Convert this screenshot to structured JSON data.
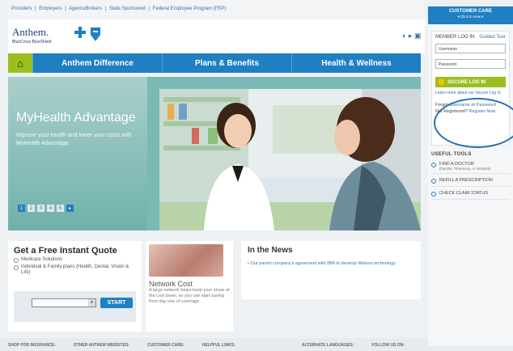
{
  "top_links": {
    "providers": "Providers",
    "employers": "Employers",
    "agents": "Agents/Brokers",
    "state": "State Sponsored",
    "federal": "Federal Employee Program (FEP)",
    "sep": "|"
  },
  "header": {
    "brand": "Anthem.",
    "tagline": "BlueCross BlueShield",
    "icons": "◐ ▸ ▣"
  },
  "nav": {
    "home_icon": "⌂",
    "items": [
      "Anthem Difference",
      "Plans & Benefits",
      "Health & Wellness"
    ]
  },
  "hero": {
    "title": "MyHealth Advantage",
    "subtitle": "Improve your health and lower your costs with MyHealth Advantage.",
    "pager": [
      "1",
      "2",
      "3",
      "4",
      "5",
      "▸"
    ]
  },
  "quote": {
    "title": "Get a Free Instant Quote",
    "options": [
      "Medicare Solutions",
      "Individual & Family plans (Health, Dental, Vision & Life)"
    ],
    "select_arrow": "▾",
    "button": "START"
  },
  "network": {
    "title": "Network Cost",
    "text": "A large network helps keep your share of the cost lower, so you can start saving from day one of coverage"
  },
  "news": {
    "title": "In the News",
    "item": "• Our parent company's agreement with IBM to develop Watson technology"
  },
  "customer_care": {
    "title": "CUSTOMER CARE",
    "sub": "▾ Click to view ▾"
  },
  "login": {
    "title": "MEMBER LOG IN",
    "tour": "Guided Tour",
    "username_placeholder": "Username",
    "password_placeholder": "Password",
    "button": "SECURE LOG IN",
    "learn": "Learn more about our Secure Log In",
    "forgot_prefix": "Forgot",
    "forgot_username": "Username",
    "or": "or",
    "forgot_password": "Password",
    "not_registered": "Not Registered?",
    "register": "Register Now"
  },
  "tools": {
    "title": "USEFUL TOOLS",
    "items": [
      {
        "label": "FIND A DOCTOR",
        "sub": "(Dentist, Pharmacy, or Hospital)"
      },
      {
        "label": "REFILL A PRESCRIPTION",
        "sub": ""
      },
      {
        "label": "CHECK CLAIM STATUS",
        "sub": ""
      }
    ]
  },
  "footer": [
    "SHOP FOR INSURANCE:",
    "OTHER ANTHEM WEBSITES:",
    "CUSTOMER CARE:",
    "HELPFUL LINKS:",
    "ALTERNATE LANGUAGES:",
    "FOLLOW US ON:"
  ]
}
